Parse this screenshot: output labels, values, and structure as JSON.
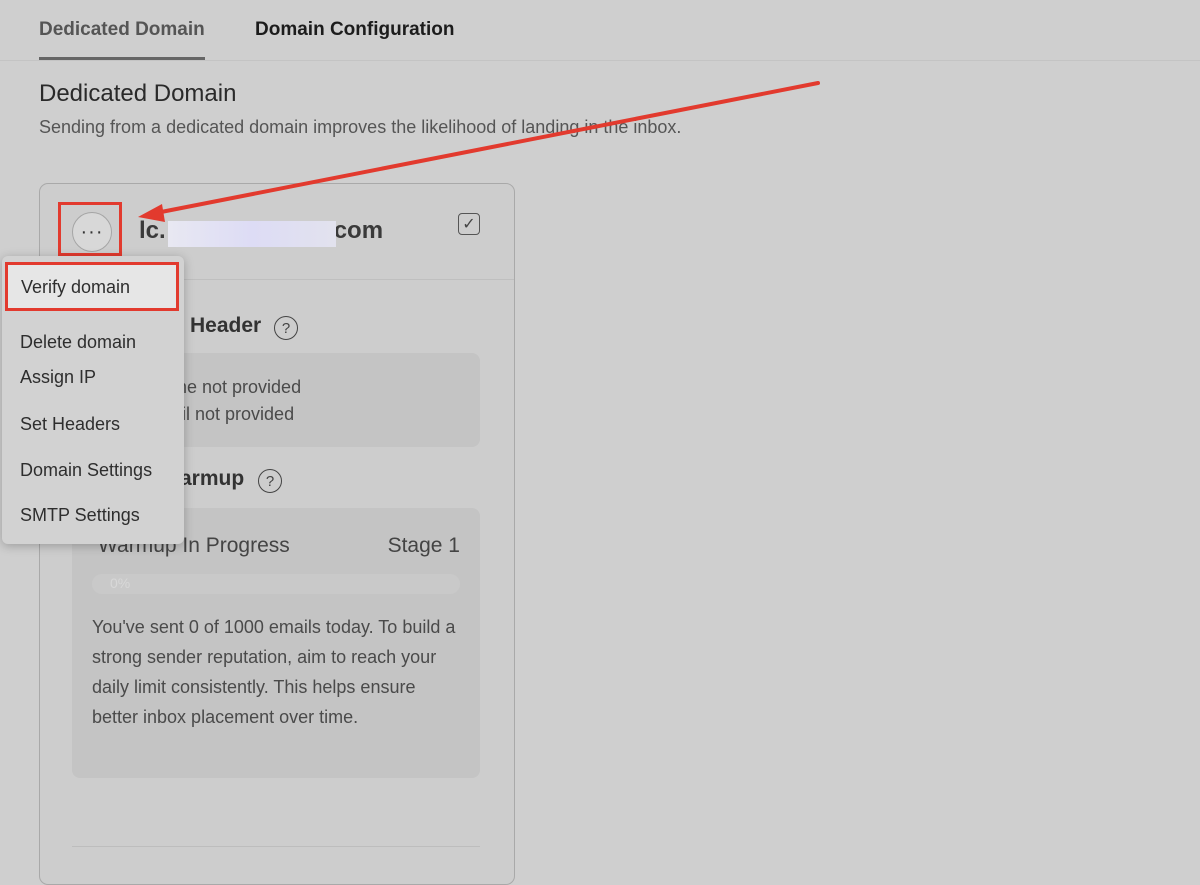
{
  "tabs": [
    {
      "label": "Dedicated Domain",
      "active": true
    },
    {
      "label": "Domain Configuration",
      "active": false
    }
  ],
  "page": {
    "title": "Dedicated Domain",
    "subtitle": "Sending from a dedicated domain improves the likelihood of landing in the inbox."
  },
  "card": {
    "domain_prefix": "lc.",
    "domain_suffix": "com",
    "more_label": "···",
    "checkbox_mark": "✓",
    "checked": true,
    "header_section": {
      "title": "Header",
      "help": "?",
      "line1": "me not provided",
      "line2": "ail not provided"
    },
    "warmup_section": {
      "title": "armup",
      "help": "?",
      "status": "Warmup In Progress",
      "stage": "Stage 1",
      "progress_label": "0%",
      "progress": 0,
      "text": "You've sent 0 of 1000 emails today. To build a strong sender reputation, aim to reach your daily limit consistently. This helps ensure better inbox placement over time."
    }
  },
  "menu": {
    "items": [
      {
        "label": "Verify domain"
      },
      {
        "label": "Delete domain"
      },
      {
        "label": "Assign IP"
      },
      {
        "label": "Set Headers"
      },
      {
        "label": "Domain Settings"
      },
      {
        "label": "SMTP Settings"
      }
    ]
  },
  "colors": {
    "highlight": "#e23a2e",
    "background": "#cfcfcf"
  }
}
